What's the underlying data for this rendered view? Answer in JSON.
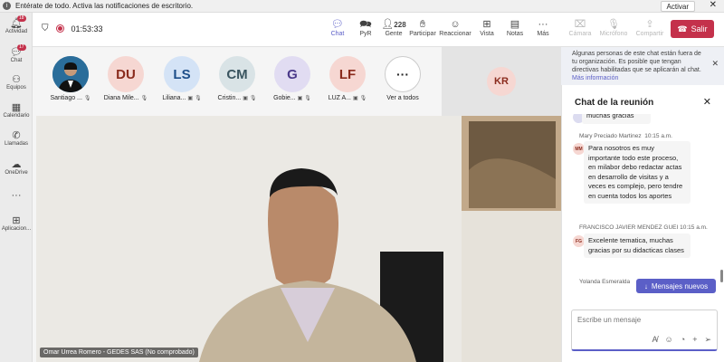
{
  "notification": {
    "text": "Entérate de todo. Activa las notificaciones de escritorio.",
    "action_label": "Activar"
  },
  "rail": [
    {
      "label": "Actividad",
      "icon": "bell-icon",
      "badge": "18"
    },
    {
      "label": "Chat",
      "icon": "chat-icon",
      "badge": "17"
    },
    {
      "label": "Equipos",
      "icon": "teams-icon"
    },
    {
      "label": "Calendario",
      "icon": "calendar-icon"
    },
    {
      "label": "Llamadas",
      "icon": "phone-icon"
    },
    {
      "label": "OneDrive",
      "icon": "cloud-icon"
    },
    {
      "label": "",
      "icon": "more-icon"
    },
    {
      "label": "Aplicacion...",
      "icon": "apps-icon"
    }
  ],
  "meeting": {
    "timer": "01:53:33"
  },
  "toolbar": {
    "chat": "Chat",
    "pyr": "PyR",
    "gente_count": "228",
    "gente": "Gente",
    "participar": "Participar",
    "reaccionar": "Reaccionar",
    "vista": "Vista",
    "notas": "Notas",
    "mas": "Más",
    "camara": "Cámara",
    "microfono": "Micrófono",
    "compartir": "Compartir",
    "salir": "Salir"
  },
  "participants": [
    {
      "initials": "",
      "name": "Santiago ...",
      "photo": true
    },
    {
      "initials": "DU",
      "name": "Diana Mile...",
      "color": "#f6d7d2",
      "fg": "#8a2b1d"
    },
    {
      "initials": "LS",
      "name": "Liliana...",
      "color": "#d4e3f6",
      "fg": "#1d4e89"
    },
    {
      "initials": "CM",
      "name": "Cristin...",
      "color": "#d9e3e6",
      "fg": "#3a5560"
    },
    {
      "initials": "G",
      "name": "Gobie...",
      "color": "#e1dcf2",
      "fg": "#4b3a8a"
    },
    {
      "initials": "LF",
      "name": "LUZ A...",
      "color": "#f6d7d2",
      "fg": "#8a2b1d"
    }
  ],
  "see_all": "Ver a todos",
  "spotlight_initials": "KR",
  "video_label": "Omar Urrea Romero - GEDES SAS (No comprobado)",
  "org_notice": {
    "text": "Algunas personas de este chat están fuera de tu organización. Es posible que tengan directivas habilitadas que se aplicarán al chat.",
    "link": "Más información"
  },
  "chat": {
    "title": "Chat de la reunión",
    "messages": [
      {
        "initials": "",
        "author": "",
        "time": "",
        "text": "muchas gracias"
      },
      {
        "initials": "MM",
        "author": "Mary Preciado Martinez",
        "time": "10:15 a.m.",
        "text": "Para nosotros es muy importante todo este proceso, en milabor debo redactar actas en desarrollo de visitas y a veces es complejo, pero tendre en cuenta todos los aportes"
      },
      {
        "initials": "FG",
        "author": "FRANCISCO JAVIER MENDEZ GUEI",
        "time": "10:15 a.m.",
        "text": "Excelente tematica, muchas gracias por su didacticas clases"
      },
      {
        "initials": "",
        "author": "Yolanda Esmeralda",
        "time": "",
        "text": ""
      }
    ],
    "new_messages": "Mensajes nuevos",
    "compose_placeholder": "Escribe un mensaje"
  }
}
